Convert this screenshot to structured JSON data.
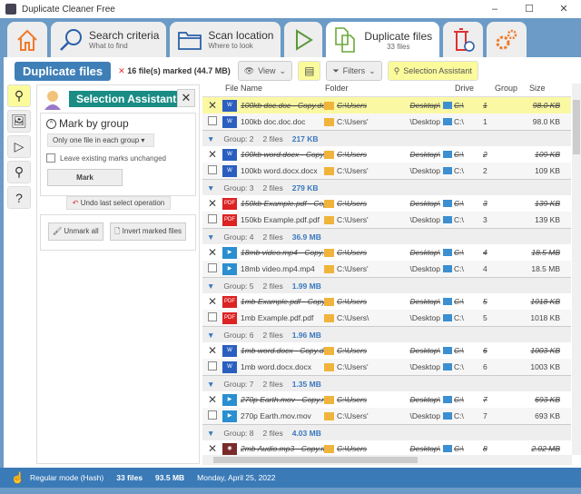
{
  "window": {
    "title": "Duplicate Cleaner Free",
    "minimize": "–",
    "maximize": "☐",
    "close": "✕"
  },
  "tabs": [
    {
      "id": "home",
      "icon": "home-icon"
    },
    {
      "id": "search",
      "title": "Search criteria",
      "subtitle": "What to find",
      "icon": "search-icon"
    },
    {
      "id": "scan",
      "title": "Scan location",
      "subtitle": "Where to look",
      "icon": "folder-icon"
    },
    {
      "id": "run",
      "icon": "play-icon"
    },
    {
      "id": "duplicates",
      "title": "Duplicate files",
      "subtitle": "33 files",
      "icon": "files-icon",
      "active": true
    },
    {
      "id": "delete",
      "icon": "trash-icon"
    },
    {
      "id": "settings",
      "icon": "gears-icon"
    }
  ],
  "toolbar": {
    "title": "Duplicate files",
    "marked_icon": "✕",
    "marked": "16 file(s) marked (44.7 MB)",
    "view": "View",
    "filters": "Filters",
    "selection_assistant": "Selection Assistant"
  },
  "panel": {
    "title": "Selection Assistant",
    "close": "✕",
    "mark_by_group": "Mark by group",
    "option": "Only one file in each group",
    "leave_marks": "Leave existing marks unchanged",
    "mark": "Mark",
    "undo": "Undo last select operation",
    "unmark_all": "Unmark all",
    "invert": "Invert marked files"
  },
  "columns": {
    "name": "File Name",
    "folder": "Folder",
    "drive": "Drive",
    "group": "Group",
    "size": "Size"
  },
  "groups": [
    {
      "label": "",
      "files": "",
      "size": "",
      "rows": [
        {
          "marked": true,
          "type": "doc",
          "name": "100kb doc.doc - Copy.doc",
          "folder": "C:\\Users",
          "fend": "Desktop\\",
          "drive": "C:\\",
          "group": "1",
          "size": "98.0 KB",
          "highlight": true
        },
        {
          "marked": false,
          "type": "doc",
          "name": "100kb doc.doc.doc",
          "folder": "C:\\Users'",
          "fend": "\\Desktop",
          "drive": "C:\\",
          "group": "1",
          "size": "98.0 KB"
        }
      ]
    },
    {
      "label": "Group: 2",
      "files": "2 files",
      "size": "217 KB",
      "rows": [
        {
          "marked": true,
          "type": "doc",
          "name": "100kb word.docx - Copy.docx",
          "folder": "C:\\Users",
          "fend": "Desktop\\",
          "drive": "C:\\",
          "group": "2",
          "size": "109 KB"
        },
        {
          "marked": false,
          "type": "doc",
          "name": "100kb word.docx.docx",
          "folder": "C:\\Users'",
          "fend": "\\Desktop",
          "drive": "C:\\",
          "group": "2",
          "size": "109 KB"
        }
      ]
    },
    {
      "label": "Group: 3",
      "files": "2 files",
      "size": "279 KB",
      "rows": [
        {
          "marked": true,
          "type": "pdf",
          "name": "150kb Example.pdf - Copy.pdf",
          "folder": "C:\\Users",
          "fend": "Desktop\\",
          "drive": "C:\\",
          "group": "3",
          "size": "139 KB"
        },
        {
          "marked": false,
          "type": "pdf",
          "name": "150kb Example.pdf.pdf",
          "folder": "C:\\Users'",
          "fend": "\\Desktop",
          "drive": "C:\\",
          "group": "3",
          "size": "139 KB"
        }
      ]
    },
    {
      "label": "Group: 4",
      "files": "2 files",
      "size": "36.9 MB",
      "rows": [
        {
          "marked": true,
          "type": "video",
          "name": "18mb video.mp4 - Copy.mp4",
          "folder": "C:\\Users",
          "fend": "Desktop\\",
          "drive": "C:\\",
          "group": "4",
          "size": "18.5 MB"
        },
        {
          "marked": false,
          "type": "video",
          "name": "18mb video.mp4.mp4",
          "folder": "C:\\Users'",
          "fend": "\\Desktop",
          "drive": "C:\\",
          "group": "4",
          "size": "18.5 MB"
        }
      ]
    },
    {
      "label": "Group: 5",
      "files": "2 files",
      "size": "1.99 MB",
      "rows": [
        {
          "marked": true,
          "type": "pdf",
          "name": "1mb Example.pdf - Copy.pdf",
          "folder": "C:\\Users",
          "fend": "Desktop\\",
          "drive": "C:\\",
          "group": "5",
          "size": "1018 KB"
        },
        {
          "marked": false,
          "type": "pdf",
          "name": "1mb Example.pdf.pdf",
          "folder": "C:\\Users\\",
          "fend": "\\Desktop",
          "drive": "C:\\",
          "group": "5",
          "size": "1018 KB"
        }
      ]
    },
    {
      "label": "Group: 6",
      "files": "2 files",
      "size": "1.96 MB",
      "rows": [
        {
          "marked": true,
          "type": "doc",
          "name": "1mb word.docx - Copy.docx",
          "folder": "C:\\Users",
          "fend": "Desktop\\",
          "drive": "C:\\",
          "group": "6",
          "size": "1003 KB"
        },
        {
          "marked": false,
          "type": "doc",
          "name": "1mb word.docx.docx",
          "folder": "C:\\Users'",
          "fend": "\\Desktop",
          "drive": "C:\\",
          "group": "6",
          "size": "1003 KB"
        }
      ]
    },
    {
      "label": "Group: 7",
      "files": "2 files",
      "size": "1.35 MB",
      "rows": [
        {
          "marked": true,
          "type": "video",
          "name": "270p Earth.mov - Copy.mov",
          "folder": "C:\\Users",
          "fend": "Desktop\\",
          "drive": "C:\\",
          "group": "7",
          "size": "693 KB"
        },
        {
          "marked": false,
          "type": "video",
          "name": "270p Earth.mov.mov",
          "folder": "C:\\Users'",
          "fend": "\\Desktop",
          "drive": "C:\\",
          "group": "7",
          "size": "693 KB"
        }
      ]
    },
    {
      "label": "Group: 8",
      "files": "2 files",
      "size": "4.03 MB",
      "rows": [
        {
          "marked": true,
          "type": "audio",
          "name": "2mb Audio.mp3 - Copy.mp3",
          "folder": "C:\\Users",
          "fend": "Desktop\\",
          "drive": "C:\\",
          "group": "8",
          "size": "2.02 MB"
        }
      ]
    }
  ],
  "status": {
    "mode": "Regular mode (Hash)",
    "files": "33 files",
    "size": "93.5 MB",
    "date": "Monday, April 25, 2022"
  },
  "colors": {
    "accent": "#3f7fb8",
    "band": "#6b9bc6",
    "status": "#3a7ab7",
    "highlight": "#fbf8a4",
    "assistant": "#1a8c84"
  }
}
